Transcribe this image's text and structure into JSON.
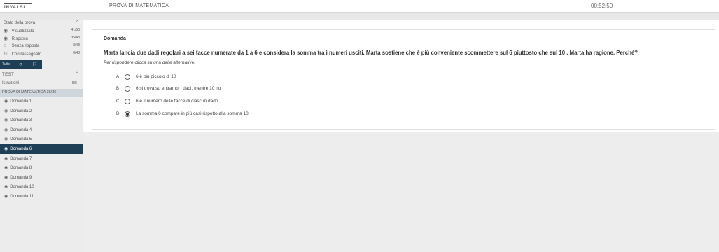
{
  "header": {
    "logo_text": "INVALSI",
    "title": "PROVA DI MATEMATICA",
    "timer": "00:52:50"
  },
  "sidebar": {
    "status_heading": "Stato della prova",
    "status": [
      {
        "label": "Visualizzato",
        "count": "41/50",
        "icon": "eye-icon"
      },
      {
        "label": "Risposto",
        "count": "35/43",
        "icon": "answered-icon"
      },
      {
        "label": "Senza risposta",
        "count": "8/43",
        "icon": "unanswered-icon"
      },
      {
        "label": "Contrassegnato",
        "count": "0/43",
        "icon": "flag-icon"
      }
    ],
    "tools_label": "Tutto",
    "test_heading": "TEST",
    "istruzioni_label": "Istruzioni",
    "istruzioni_count": "5/5",
    "section_label": "PROVA DI MATEMATICA 36/36",
    "questions": [
      {
        "label": "Domanda 1",
        "current": false
      },
      {
        "label": "Domanda 2",
        "current": false
      },
      {
        "label": "Domanda 3",
        "current": false
      },
      {
        "label": "Domanda 4",
        "current": false
      },
      {
        "label": "Domanda 5",
        "current": false
      },
      {
        "label": "Domanda 6",
        "current": true
      },
      {
        "label": "Domanda 7",
        "current": false
      },
      {
        "label": "Domanda 8",
        "current": false
      },
      {
        "label": "Domanda 9",
        "current": false
      },
      {
        "label": "Domanda 10",
        "current": false
      },
      {
        "label": "Domanda 11",
        "current": false
      }
    ]
  },
  "question": {
    "heading": "Domanda",
    "text": "Marta lancia due dadi regolari a sei facce numerate da 1 a 6 e considera la somma tra i numeri usciti. Marta sostiene che è più conveniente scommettere sul 6 piuttosto che sul 10 . Marta ha ragione. Perché?",
    "instruction": "Per rispondere clicca su una delle alternative.",
    "options": [
      {
        "letter": "A",
        "text": "6 è più piccolo di 10",
        "selected": false
      },
      {
        "letter": "B",
        "text": "6 si trova su entrambi i dadi, mentre 10 no",
        "selected": false
      },
      {
        "letter": "C",
        "text": "6 è il numero delle facce di ciascun dado",
        "selected": false
      },
      {
        "letter": "D",
        "text": "La somma 6 compare in più casi rispetto alla somma 10",
        "selected": true
      }
    ]
  }
}
